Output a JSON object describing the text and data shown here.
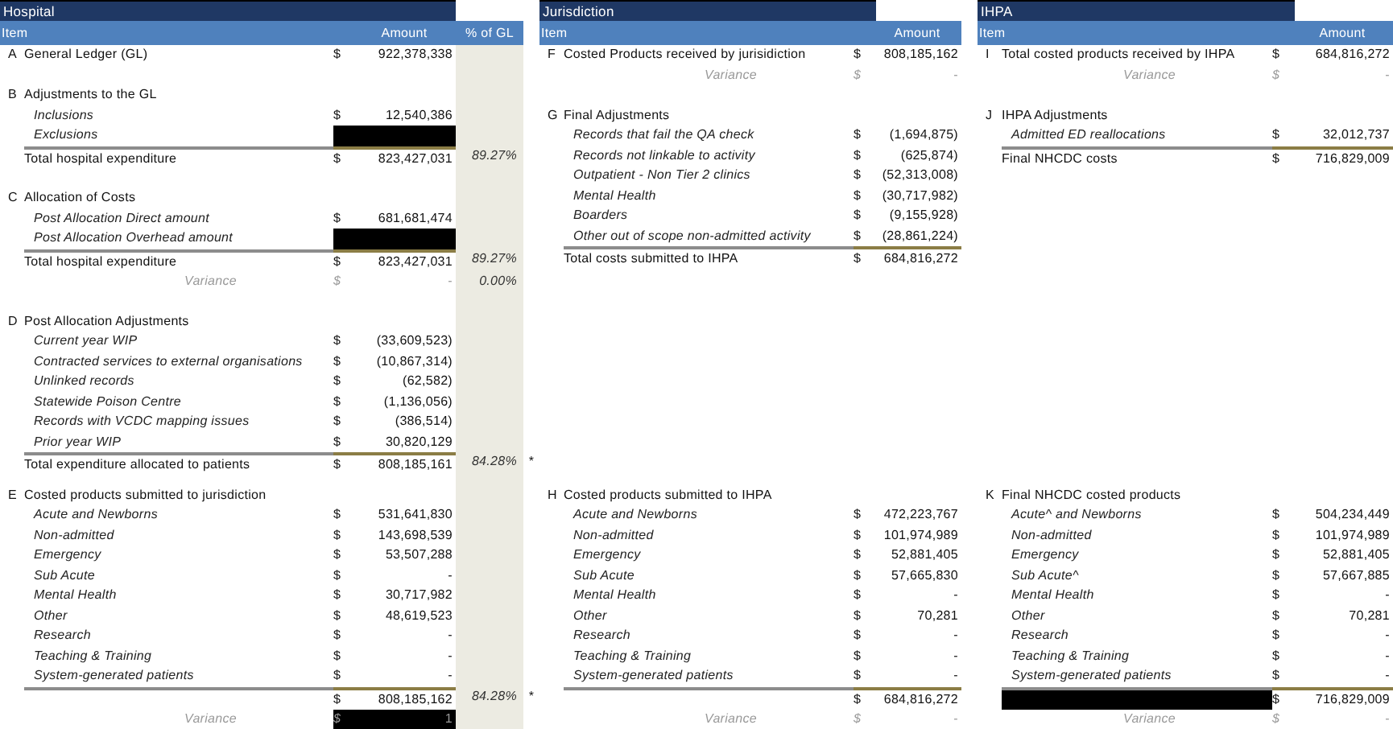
{
  "panels": [
    {
      "title": "Hospital",
      "columns": [
        "Item",
        "Amount",
        "% of GL"
      ],
      "sections": [
        {
          "letter": "A",
          "title": "General Ledger (GL)",
          "currency": "$",
          "amount": "922,378,338"
        },
        {
          "letter": "B",
          "title": "Adjustments to the GL",
          "items": [
            {
              "label": "Inclusions",
              "currency": "$",
              "amount": "12,540,386",
              "redacted": false
            },
            {
              "label": "Exclusions",
              "redacted": true
            }
          ],
          "total": {
            "label": "Total hospital expenditure",
            "currency": "$",
            "amount": "823,427,031",
            "percent": "89.27%"
          }
        },
        {
          "letter": "C",
          "title": "Allocation of Costs",
          "items": [
            {
              "label": "Post Allocation Direct amount",
              "currency": "$",
              "amount": "681,681,474",
              "redacted": false
            },
            {
              "label": "Post Allocation Overhead amount",
              "redacted": true
            }
          ],
          "total": {
            "label": "Total hospital expenditure",
            "currency": "$",
            "amount": "823,427,031",
            "percent": "89.27%"
          },
          "variance": {
            "label": "Variance",
            "currency": "$",
            "amount": "-",
            "percent": "0.00%",
            "highlighted": false
          }
        },
        {
          "letter": "D",
          "title": "Post Allocation Adjustments",
          "items": [
            {
              "label": "Current year WIP",
              "currency": "$",
              "amount": "(33,609,523)",
              "redacted": false
            },
            {
              "label": "Contracted services to external organisations",
              "currency": "$",
              "amount": "(10,867,314)",
              "redacted": false
            },
            {
              "label": "Unlinked records",
              "currency": "$",
              "amount": "(62,582)",
              "redacted": false
            },
            {
              "label": "Statewide Poison Centre",
              "currency": "$",
              "amount": "(1,136,056)",
              "redacted": false
            },
            {
              "label": "Records with VCDC mapping issues",
              "currency": "$",
              "amount": "(386,514)",
              "redacted": false
            },
            {
              "label": "Prior year WIP",
              "currency": "$",
              "amount": "30,820,129",
              "redacted": false
            }
          ],
          "total": {
            "label": "Total expenditure allocated to patients",
            "currency": "$",
            "amount": "808,185,161",
            "percent": "84.28%",
            "note": "*"
          }
        },
        {
          "letter": "E",
          "title": "Costed products submitted to jurisdiction",
          "items": [
            {
              "label": "Acute and Newborns",
              "currency": "$",
              "amount": "531,641,830",
              "redacted": false
            },
            {
              "label": "Non-admitted",
              "currency": "$",
              "amount": "143,698,539",
              "redacted": false
            },
            {
              "label": "Emergency",
              "currency": "$",
              "amount": "53,507,288",
              "redacted": false
            },
            {
              "label": "Sub Acute",
              "currency": "$",
              "amount": "-",
              "redacted": false
            },
            {
              "label": "Mental Health",
              "currency": "$",
              "amount": "30,717,982",
              "redacted": false
            },
            {
              "label": "Other",
              "currency": "$",
              "amount": "48,619,523",
              "redacted": false
            },
            {
              "label": "Research",
              "currency": "$",
              "amount": "-",
              "redacted": false
            },
            {
              "label": "Teaching & Training",
              "currency": "$",
              "amount": "-",
              "redacted": false
            },
            {
              "label": "System-generated patients",
              "currency": "$",
              "amount": "-",
              "redacted": false
            }
          ],
          "total": {
            "currency": "$",
            "amount": "808,185,162",
            "percent": "84.28%",
            "note": "*"
          },
          "variance": {
            "label": "Variance",
            "currency": "$",
            "amount": "1",
            "highlighted": true
          }
        }
      ]
    },
    {
      "title": "Jurisdiction",
      "columns": [
        "Item",
        "Amount"
      ],
      "sections": [
        {
          "letter": "F",
          "title": "Costed Products received by jurisidiction",
          "currency": "$",
          "amount": "808,185,162",
          "variance": {
            "label": "Variance",
            "currency": "$",
            "amount": "-",
            "highlighted": false
          }
        },
        {
          "letter": "G",
          "title": "Final Adjustments",
          "items": [
            {
              "label": "Records that fail the QA check",
              "currency": "$",
              "amount": "(1,694,875)",
              "redacted": false
            },
            {
              "label": "Records not linkable to activity",
              "currency": "$",
              "amount": "(625,874)",
              "redacted": false
            },
            {
              "label": "Outpatient - Non Tier 2 clinics",
              "currency": "$",
              "amount": "(52,313,008)",
              "redacted": false
            },
            {
              "label": "Mental Health",
              "currency": "$",
              "amount": "(30,717,982)",
              "redacted": false
            },
            {
              "label": "Boarders",
              "currency": "$",
              "amount": "(9,155,928)",
              "redacted": false
            },
            {
              "label": "Other out of scope non-admitted activity",
              "currency": "$",
              "amount": "(28,861,224)",
              "redacted": false
            }
          ],
          "total": {
            "label": "Total costs submitted to IHPA",
            "currency": "$",
            "amount": "684,816,272"
          }
        },
        {
          "letter": "H",
          "title": "Costed products submitted to IHPA",
          "items": [
            {
              "label": "Acute and Newborns",
              "currency": "$",
              "amount": "472,223,767",
              "redacted": false
            },
            {
              "label": "Non-admitted",
              "currency": "$",
              "amount": "101,974,989",
              "redacted": false
            },
            {
              "label": "Emergency",
              "currency": "$",
              "amount": "52,881,405",
              "redacted": false
            },
            {
              "label": "Sub Acute",
              "currency": "$",
              "amount": "57,665,830",
              "redacted": false
            },
            {
              "label": "Mental Health",
              "currency": "$",
              "amount": "-",
              "redacted": false
            },
            {
              "label": "Other",
              "currency": "$",
              "amount": "70,281",
              "redacted": false
            },
            {
              "label": "Research",
              "currency": "$",
              "amount": "-",
              "redacted": false
            },
            {
              "label": "Teaching & Training",
              "currency": "$",
              "amount": "-",
              "redacted": false
            },
            {
              "label": "System-generated patients",
              "currency": "$",
              "amount": "-",
              "redacted": false
            }
          ],
          "total": {
            "currency": "$",
            "amount": "684,816,272"
          },
          "variance": {
            "label": "Variance",
            "currency": "$",
            "amount": "-",
            "highlighted": false
          }
        }
      ]
    },
    {
      "title": "IHPA",
      "columns": [
        "Item",
        "Amount"
      ],
      "sections": [
        {
          "letter": "I",
          "title": "Total costed products received by IHPA",
          "currency": "$",
          "amount": "684,816,272",
          "variance": {
            "label": "Variance",
            "currency": "$",
            "amount": "-",
            "highlighted": false
          }
        },
        {
          "letter": "J",
          "title": "IHPA Adjustments",
          "items": [
            {
              "label": "Admitted ED reallocations",
              "currency": "$",
              "amount": "32,012,737",
              "redacted": false
            }
          ],
          "total": {
            "label": "Final NHCDC costs",
            "currency": "$",
            "amount": "716,829,009"
          }
        },
        {
          "letter": "K",
          "title": "Final NHCDC costed products",
          "items": [
            {
              "label": "Acute^ and Newborns",
              "currency": "$",
              "amount": "504,234,449",
              "redacted": false
            },
            {
              "label": "Non-admitted",
              "currency": "$",
              "amount": "101,974,989",
              "redacted": false
            },
            {
              "label": "Emergency",
              "currency": "$",
              "amount": "52,881,405",
              "redacted": false
            },
            {
              "label": "Sub Acute^",
              "currency": "$",
              "amount": "57,667,885",
              "redacted": false
            },
            {
              "label": "Mental Health",
              "currency": "$",
              "amount": "-",
              "redacted": false
            },
            {
              "label": "Other",
              "currency": "$",
              "amount": "70,281",
              "redacted": false
            },
            {
              "label": "Research",
              "currency": "$",
              "amount": "-",
              "redacted": false
            },
            {
              "label": "Teaching & Training",
              "currency": "$",
              "amount": "-",
              "redacted": false
            },
            {
              "label": "System-generated patients",
              "currency": "$",
              "amount": "-",
              "redacted": false
            }
          ],
          "total": {
            "label_redacted": true,
            "currency": "$",
            "amount": "716,829,009"
          },
          "variance": {
            "label": "Variance",
            "currency": "$",
            "amount": "-",
            "highlighted": false
          }
        }
      ]
    }
  ]
}
